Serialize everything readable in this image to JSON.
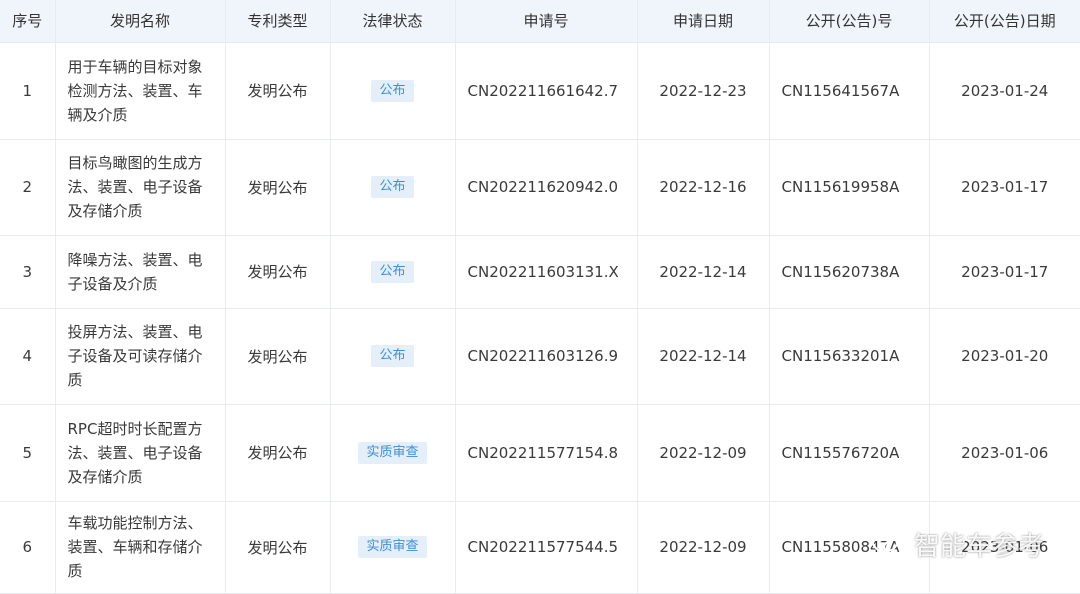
{
  "columns": [
    "序号",
    "发明名称",
    "专利类型",
    "法律状态",
    "申请号",
    "申请日期",
    "公开(公告)号",
    "公开(公告)日期"
  ],
  "rows": [
    {
      "no": "1",
      "name": "用于车辆的目标对象检测方法、装置、车辆及介质",
      "type": "发明公布",
      "status": "公布",
      "app_no": "CN202211661642.7",
      "app_date": "2022-12-23",
      "pub_no": "CN115641567A",
      "pub_date": "2023-01-24"
    },
    {
      "no": "2",
      "name": "目标鸟瞰图的生成方法、装置、电子设备及存储介质",
      "type": "发明公布",
      "status": "公布",
      "app_no": "CN202211620942.0",
      "app_date": "2022-12-16",
      "pub_no": "CN115619958A",
      "pub_date": "2023-01-17"
    },
    {
      "no": "3",
      "name": "降噪方法、装置、电子设备及介质",
      "type": "发明公布",
      "status": "公布",
      "app_no": "CN202211603131.X",
      "app_date": "2022-12-14",
      "pub_no": "CN115620738A",
      "pub_date": "2023-01-17"
    },
    {
      "no": "4",
      "name": "投屏方法、装置、电子设备及可读存储介质",
      "type": "发明公布",
      "status": "公布",
      "app_no": "CN202211603126.9",
      "app_date": "2022-12-14",
      "pub_no": "CN115633201A",
      "pub_date": "2023-01-20"
    },
    {
      "no": "5",
      "name": "RPC超时时长配置方法、装置、电子设备及存储介质",
      "type": "发明公布",
      "status": "实质审查",
      "app_no": "CN202211577154.8",
      "app_date": "2022-12-09",
      "pub_no": "CN115576720A",
      "pub_date": "2023-01-06"
    },
    {
      "no": "6",
      "name": "车载功能控制方法、装置、车辆和存储介质",
      "type": "发明公布",
      "status": "实质审查",
      "app_no": "CN202211577544.5",
      "app_date": "2022-12-09",
      "pub_no": "CN115580847A",
      "pub_date": "2023-01-06"
    }
  ],
  "watermark": {
    "text": "智能车参考",
    "icon": "wechat-icon"
  }
}
